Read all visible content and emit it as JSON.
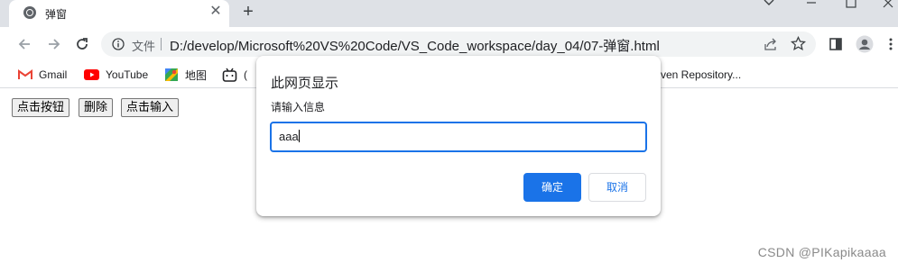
{
  "tab": {
    "title": "弹窗",
    "close": "✕"
  },
  "new_tab": "+",
  "window_controls": {
    "dropdown": "⌄",
    "minimize": "—",
    "maximize": "☐",
    "close": "✕"
  },
  "address": {
    "scheme_label": "文件",
    "url": "D:/develop/Microsoft%20VS%20Code/VS_Code_workspace/day_04/07-弹窗.html"
  },
  "bookmarks": [
    {
      "label": "Gmail",
      "icon": "gmail-icon"
    },
    {
      "label": "YouTube",
      "icon": "youtube-icon"
    },
    {
      "label": "地图",
      "icon": "maps-icon"
    },
    {
      "label": "(",
      "icon": "bilibili-icon"
    },
    {
      "label": "ven Repository...",
      "icon": ""
    }
  ],
  "page_buttons": {
    "click": "点击按钮",
    "delete": "删除",
    "input": "点击输入"
  },
  "dialog": {
    "title": "此网页显示",
    "message": "请输入信息",
    "input_value": "aaa",
    "ok_label": "确定",
    "cancel_label": "取消"
  },
  "watermark": "CSDN @PIKapikaaaa",
  "colors": {
    "accent": "#1a73e8",
    "tabstrip": "#dee1e6",
    "omnibox": "#f1f3f4"
  }
}
